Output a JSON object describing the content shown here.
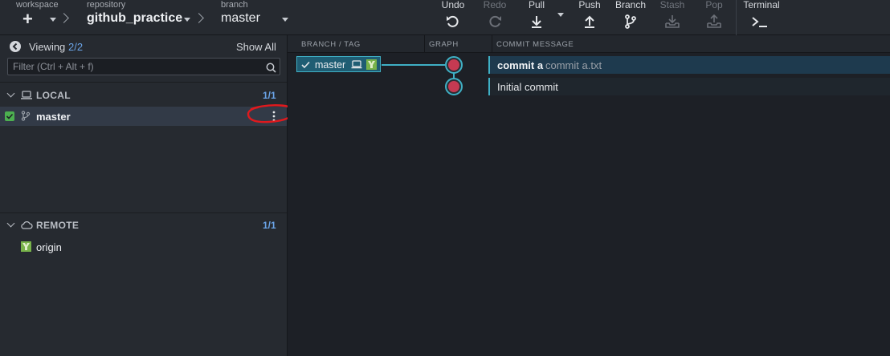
{
  "toolbar": {
    "workspace_label": "workspace",
    "repository_label": "repository",
    "repository_name": "github_practice",
    "branch_label": "branch",
    "branch_name": "master",
    "undo": "Undo",
    "redo": "Redo",
    "pull": "Pull",
    "push": "Push",
    "branch": "Branch",
    "stash": "Stash",
    "pop": "Pop",
    "terminal": "Terminal"
  },
  "left": {
    "viewing_label": "Viewing",
    "viewing_count": "2/2",
    "show_all": "Show All",
    "filter_placeholder": "Filter (Ctrl + Alt + f)",
    "local": {
      "title": "LOCAL",
      "count": "1/1",
      "branches": [
        {
          "name": "master",
          "checked": true
        }
      ]
    },
    "remote": {
      "title": "REMOTE",
      "count": "1/1",
      "remotes": [
        {
          "name": "origin"
        }
      ]
    }
  },
  "main": {
    "columns": {
      "branch_tag": "BRANCH / TAG",
      "graph": "GRAPH",
      "commit_message": "COMMIT MESSAGE"
    },
    "head_branch": "master",
    "commits": [
      {
        "summary": "commit a",
        "description": "commit a.txt",
        "selected": true
      },
      {
        "summary": "Initial commit",
        "description": "",
        "selected": false
      }
    ]
  },
  "colors": {
    "accent": "#3fb0c5",
    "selection": "#1e3a4e",
    "node": "#c53a52",
    "check": "#4caf50"
  }
}
